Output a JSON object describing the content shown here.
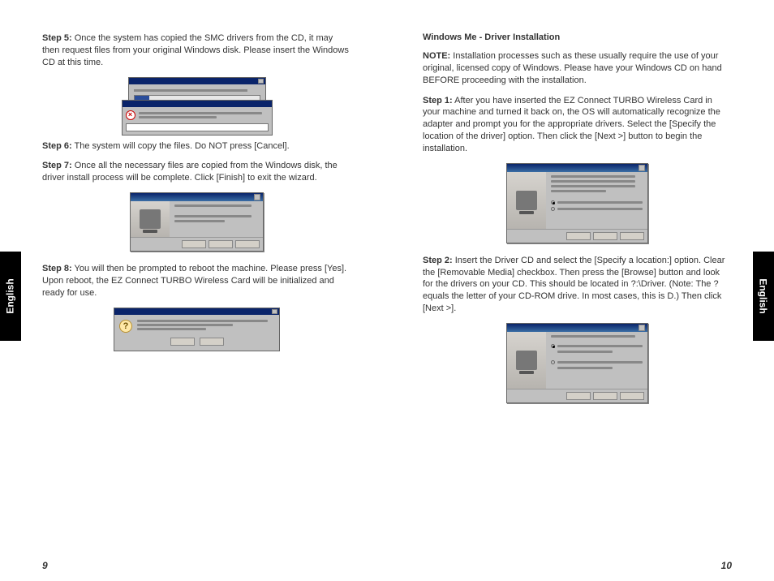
{
  "tabs": {
    "left": "English",
    "right": "English"
  },
  "left": {
    "step5": {
      "label": "Step 5:",
      "text": "Once the system has copied the SMC drivers from the CD, it may then request files from your original Windows disk. Please insert the Windows CD at this time."
    },
    "step6": {
      "label": "Step 6:",
      "text": "The system will copy the files. Do NOT press [Cancel]."
    },
    "step7": {
      "label": "Step 7:",
      "text": "Once all the necessary files are copied from the Windows disk, the driver install process will be complete. Click [Finish] to exit the wizard."
    },
    "step8": {
      "label": "Step 8:",
      "text": "You will then be prompted to reboot the machine. Please press [Yes]. Upon reboot, the EZ Connect TURBO Wireless Card will be initialized and ready for use."
    },
    "pagenum": "9"
  },
  "right": {
    "title": "Windows Me - Driver Installation",
    "note": {
      "label": "NOTE:",
      "text": "Installation processes such as these usually require the use of your original, licensed copy of Windows. Please have your Windows CD on hand BEFORE proceeding with the installation."
    },
    "step1": {
      "label": "Step 1:",
      "text": "After you have inserted the EZ Connect TURBO Wireless Card in your machine and turned it back on, the OS will automatically recognize the adapter and prompt you for the appropriate drivers. Select the [Specify the location of the driver] option. Then click the [Next >] button to begin the installation."
    },
    "step2": {
      "label": "Step 2:",
      "text": "Insert the Driver CD and select the [Specify a location:] option. Clear the [Removable Media] checkbox. Then press the [Browse] button and look for the drivers on your CD. This should be located in ?:\\Driver. (Note: The ? equals the letter of your CD-ROM drive. In most cases, this is D.) Then click [Next >]."
    },
    "pagenum": "10"
  }
}
